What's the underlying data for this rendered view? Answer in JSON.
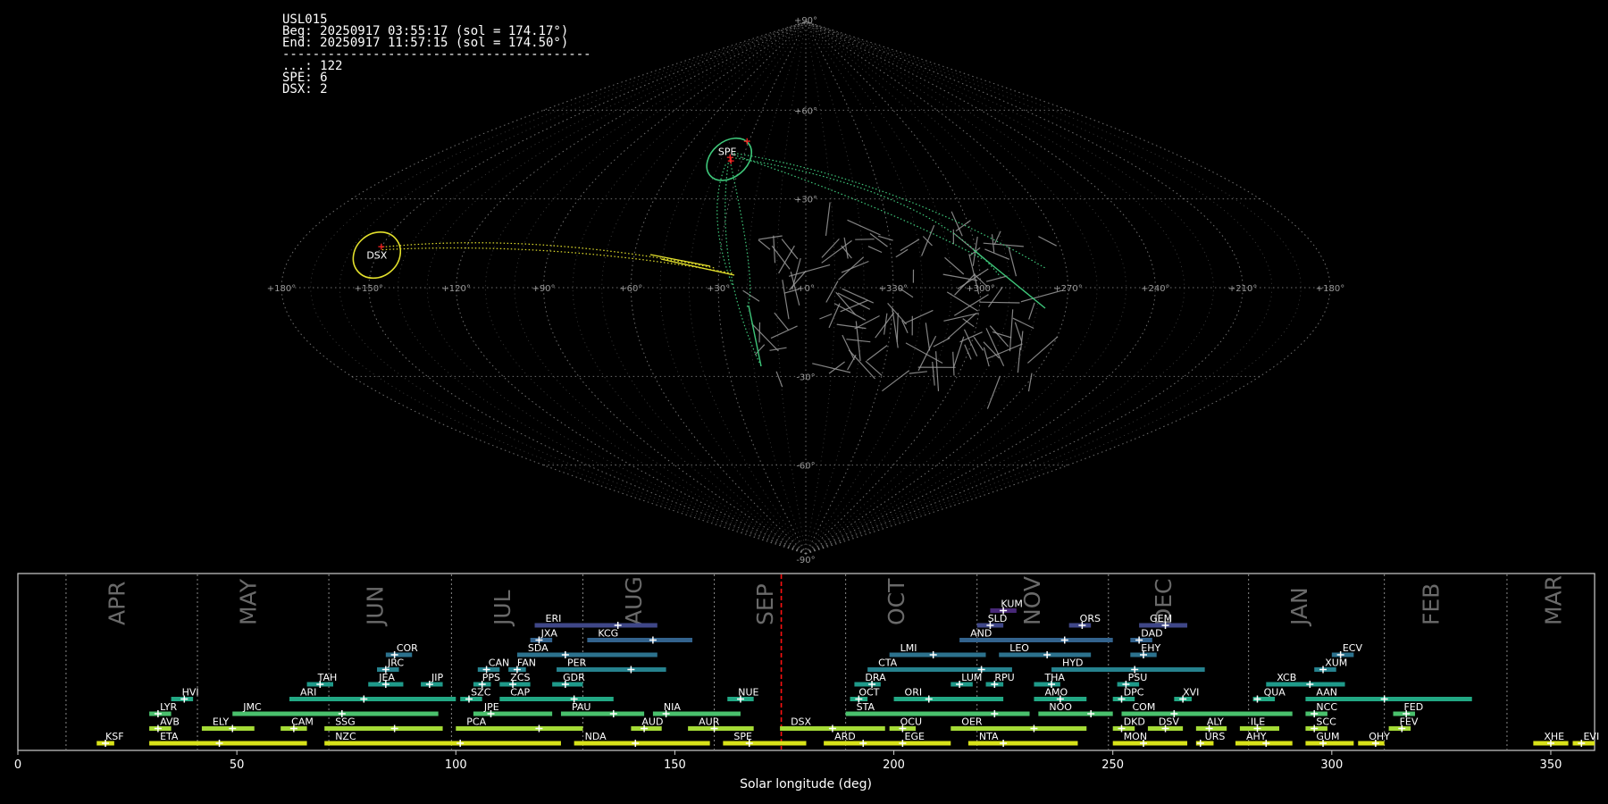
{
  "info": {
    "station": "USL015",
    "beg": "Beg: 20250917 03:55:17 (sol = 174.17°)",
    "end": "End: 20250917 11:57:15 (sol = 174.50°)",
    "separator": "-----------------------------------------",
    "counts": [
      "...: 122",
      "SPE: 6",
      "DSX: 2"
    ]
  },
  "colors": {
    "background": "#000000",
    "grid": "#8a8a8a",
    "sporadic_meteors": "#9a9a9a",
    "spe": "#3ec77a",
    "dsx": "#e3e02c",
    "radiant_marker": "#ff2020",
    "current_sol": "#ff1010"
  },
  "chart_data": [
    {
      "type": "scatter",
      "projection": "sinusoidal",
      "title": "",
      "lon_tick_labels": [
        "+180°",
        "+150°",
        "+120°",
        "+90°",
        "+60°",
        "+30°",
        "+0°",
        "+330°",
        "+300°",
        "+270°",
        "+240°",
        "+210°",
        "+180°"
      ],
      "lat_tick_labels": [
        "+90°",
        "+60°",
        "+30°",
        "-30°",
        "-60°",
        "-90°"
      ],
      "radiants": [
        {
          "name": "SPE",
          "lon": 37,
          "lat": 44,
          "count": 6
        },
        {
          "name": "DSX",
          "lon": 150,
          "lat": 11,
          "count": 2
        }
      ],
      "sporadic_count": 122
    },
    {
      "type": "gantt",
      "title": "",
      "xlabel": "Solar longitude (deg)",
      "xlim": [
        0,
        360
      ],
      "xticks": [
        0,
        50,
        100,
        150,
        200,
        250,
        300,
        350
      ],
      "current_sol": 174.3,
      "month_boundaries": [
        11,
        41,
        71,
        99,
        129,
        159,
        189,
        219,
        249,
        281,
        312,
        340
      ],
      "months": [
        {
          "label": "APR",
          "sol": 26
        },
        {
          "label": "MAY",
          "sol": 56
        },
        {
          "label": "JUN",
          "sol": 85
        },
        {
          "label": "JUL",
          "sol": 114
        },
        {
          "label": "AUG",
          "sol": 144
        },
        {
          "label": "SEP",
          "sol": 174
        },
        {
          "label": "OCT",
          "sol": 204
        },
        {
          "label": "NOV",
          "sol": 235
        },
        {
          "label": "DEC",
          "sol": 265
        },
        {
          "label": "JAN",
          "sol": 296
        },
        {
          "label": "FEB",
          "sol": 326
        },
        {
          "label": "MAR",
          "sol": 354
        }
      ],
      "showers": [
        {
          "code": "KSF",
          "start": 18,
          "end": 22,
          "peak": 20,
          "row": 0
        },
        {
          "code": "ETA",
          "start": 30,
          "end": 66,
          "peak": 46,
          "row": 0
        },
        {
          "code": "NZC",
          "start": 70,
          "end": 124,
          "peak": 101,
          "row": 0
        },
        {
          "code": "NDA",
          "start": 127,
          "end": 158,
          "peak": 141,
          "row": 0
        },
        {
          "code": "SPE",
          "start": 161,
          "end": 180,
          "peak": 167,
          "row": 0
        },
        {
          "code": "ARD",
          "start": 184,
          "end": 201,
          "peak": 193,
          "row": 0
        },
        {
          "code": "EGE",
          "start": 200,
          "end": 213,
          "peak": 202,
          "row": 0
        },
        {
          "code": "NTA",
          "start": 217,
          "end": 242,
          "peak": 225,
          "row": 0
        },
        {
          "code": "MON",
          "start": 250,
          "end": 267,
          "peak": 257,
          "row": 0
        },
        {
          "code": "URS",
          "start": 269,
          "end": 273,
          "peak": 270,
          "row": 0
        },
        {
          "code": "AHY",
          "start": 278,
          "end": 291,
          "peak": 285,
          "row": 0
        },
        {
          "code": "GUM",
          "start": 294,
          "end": 305,
          "peak": 298,
          "row": 0
        },
        {
          "code": "OHY",
          "start": 306,
          "end": 312,
          "peak": 310,
          "row": 0
        },
        {
          "code": "XHE",
          "start": 346,
          "end": 354,
          "peak": 350,
          "row": 0
        },
        {
          "code": "EVI",
          "start": 355,
          "end": 360,
          "peak": 357,
          "row": 0
        },
        {
          "code": "AVB",
          "start": 30,
          "end": 35,
          "peak": 32,
          "row": 1
        },
        {
          "code": "ELY",
          "start": 42,
          "end": 54,
          "peak": 49,
          "row": 1
        },
        {
          "code": "CAM",
          "start": 60,
          "end": 66,
          "peak": 63,
          "row": 1
        },
        {
          "code": "SSG",
          "start": 70,
          "end": 97,
          "peak": 86,
          "row": 1
        },
        {
          "code": "PCA",
          "start": 100,
          "end": 129,
          "peak": 119,
          "row": 1
        },
        {
          "code": "AUD",
          "start": 140,
          "end": 147,
          "peak": 143,
          "row": 1
        },
        {
          "code": "AUR",
          "start": 153,
          "end": 168,
          "peak": 159,
          "row": 1
        },
        {
          "code": "DSX",
          "start": 174,
          "end": 198,
          "peak": 186,
          "row": 1
        },
        {
          "code": "OCU",
          "start": 199,
          "end": 205,
          "peak": 202,
          "row": 1
        },
        {
          "code": "OER",
          "start": 213,
          "end": 244,
          "peak": 232,
          "row": 1
        },
        {
          "code": "DKD",
          "start": 250,
          "end": 255,
          "peak": 252,
          "row": 1
        },
        {
          "code": "DSV",
          "start": 258,
          "end": 266,
          "peak": 262,
          "row": 1
        },
        {
          "code": "ALY",
          "start": 269,
          "end": 276,
          "peak": 272,
          "row": 1
        },
        {
          "code": "ILE",
          "start": 279,
          "end": 288,
          "peak": 283,
          "row": 1
        },
        {
          "code": "SCC",
          "start": 294,
          "end": 299,
          "peak": 296,
          "row": 1
        },
        {
          "code": "FEV",
          "start": 313,
          "end": 318,
          "peak": 316,
          "row": 1
        },
        {
          "code": "LYR",
          "start": 30,
          "end": 35,
          "peak": 32,
          "row": 2
        },
        {
          "code": "JMC",
          "start": 49,
          "end": 96,
          "peak": 74,
          "row": 2
        },
        {
          "code": "JPE",
          "start": 104,
          "end": 122,
          "peak": 108,
          "row": 2
        },
        {
          "code": "PAU",
          "start": 124,
          "end": 143,
          "peak": 136,
          "row": 2
        },
        {
          "code": "NIA",
          "start": 145,
          "end": 165,
          "peak": 148,
          "row": 2
        },
        {
          "code": "STA",
          "start": 189,
          "end": 231,
          "peak": 223,
          "row": 2
        },
        {
          "code": "NOO",
          "start": 233,
          "end": 250,
          "peak": 245,
          "row": 2
        },
        {
          "code": "COM",
          "start": 252,
          "end": 291,
          "peak": 264,
          "row": 2
        },
        {
          "code": "NCC",
          "start": 294,
          "end": 299,
          "peak": 296,
          "row": 2
        },
        {
          "code": "FED",
          "start": 314,
          "end": 319,
          "peak": 317,
          "row": 2
        },
        {
          "code": "HVI",
          "start": 35,
          "end": 40,
          "peak": 38,
          "row": 3
        },
        {
          "code": "ARI",
          "start": 62,
          "end": 100,
          "peak": 79,
          "row": 3
        },
        {
          "code": "SZC",
          "start": 101,
          "end": 106,
          "peak": 103,
          "row": 3
        },
        {
          "code": "CAP",
          "start": 110,
          "end": 136,
          "peak": 127,
          "row": 3
        },
        {
          "code": "NUE",
          "start": 162,
          "end": 168,
          "peak": 165,
          "row": 3
        },
        {
          "code": "OCT",
          "start": 190,
          "end": 194,
          "peak": 192,
          "row": 3
        },
        {
          "code": "ORI",
          "start": 200,
          "end": 225,
          "peak": 208,
          "row": 3
        },
        {
          "code": "AMO",
          "start": 232,
          "end": 244,
          "peak": 238,
          "row": 3
        },
        {
          "code": "DPC",
          "start": 250,
          "end": 255,
          "peak": 252,
          "row": 3
        },
        {
          "code": "XVI",
          "start": 264,
          "end": 268,
          "peak": 266,
          "row": 3
        },
        {
          "code": "QUA",
          "start": 282,
          "end": 287,
          "peak": 283,
          "row": 3
        },
        {
          "code": "AAN",
          "start": 294,
          "end": 332,
          "peak": 312,
          "row": 3
        },
        {
          "code": "TAH",
          "start": 66,
          "end": 72,
          "peak": 69,
          "row": 4
        },
        {
          "code": "JEA",
          "start": 80,
          "end": 88,
          "peak": 84,
          "row": 4
        },
        {
          "code": "JIP",
          "start": 92,
          "end": 97,
          "peak": 94,
          "row": 4
        },
        {
          "code": "PPS",
          "start": 104,
          "end": 108,
          "peak": 106,
          "row": 4
        },
        {
          "code": "ZCS",
          "start": 110,
          "end": 117,
          "peak": 113,
          "row": 4
        },
        {
          "code": "GDR",
          "start": 122,
          "end": 129,
          "peak": 125,
          "row": 4
        },
        {
          "code": "DRA",
          "start": 191,
          "end": 197,
          "peak": 195,
          "row": 4
        },
        {
          "code": "LUM",
          "start": 213,
          "end": 218,
          "peak": 215,
          "row": 4
        },
        {
          "code": "RPU",
          "start": 221,
          "end": 225,
          "peak": 223,
          "row": 4
        },
        {
          "code": "THA",
          "start": 232,
          "end": 238,
          "peak": 236,
          "row": 4
        },
        {
          "code": "PSU",
          "start": 251,
          "end": 256,
          "peak": 253,
          "row": 4
        },
        {
          "code": "XCB",
          "start": 285,
          "end": 303,
          "peak": 295,
          "row": 4
        },
        {
          "code": "JRC",
          "start": 82,
          "end": 87,
          "peak": 84,
          "row": 5
        },
        {
          "code": "CAN",
          "start": 105,
          "end": 110,
          "peak": 107,
          "row": 5
        },
        {
          "code": "FAN",
          "start": 112,
          "end": 116,
          "peak": 114,
          "row": 5
        },
        {
          "code": "PER",
          "start": 123,
          "end": 148,
          "peak": 140,
          "row": 5
        },
        {
          "code": "CTA",
          "start": 194,
          "end": 227,
          "peak": 220,
          "row": 5
        },
        {
          "code": "HYD",
          "start": 236,
          "end": 271,
          "peak": 255,
          "row": 5
        },
        {
          "code": "XUM",
          "start": 296,
          "end": 301,
          "peak": 298,
          "row": 5
        },
        {
          "code": "COR",
          "start": 84,
          "end": 90,
          "peak": 86,
          "row": 6
        },
        {
          "code": "SDA",
          "start": 114,
          "end": 146,
          "peak": 125,
          "row": 6
        },
        {
          "code": "LMI",
          "start": 199,
          "end": 221,
          "peak": 209,
          "row": 6
        },
        {
          "code": "LEO",
          "start": 224,
          "end": 245,
          "peak": 235,
          "row": 6
        },
        {
          "code": "EHY",
          "start": 254,
          "end": 260,
          "peak": 257,
          "row": 6
        },
        {
          "code": "ECV",
          "start": 300,
          "end": 305,
          "peak": 302,
          "row": 6
        },
        {
          "code": "JXA",
          "start": 117,
          "end": 122,
          "peak": 119,
          "row": 7
        },
        {
          "code": "KCG",
          "start": 130,
          "end": 154,
          "peak": 145,
          "row": 7
        },
        {
          "code": "AND",
          "start": 215,
          "end": 250,
          "peak": 239,
          "row": 7
        },
        {
          "code": "DAD",
          "start": 254,
          "end": 259,
          "peak": 256,
          "row": 7
        },
        {
          "code": "ERI",
          "start": 118,
          "end": 146,
          "peak": 137,
          "row": 8
        },
        {
          "code": "SLD",
          "start": 219,
          "end": 225,
          "peak": 222,
          "row": 8
        },
        {
          "code": "ORS",
          "start": 240,
          "end": 245,
          "peak": 243,
          "row": 8
        },
        {
          "code": "GEM",
          "start": 256,
          "end": 267,
          "peak": 262,
          "row": 8
        },
        {
          "code": "KUM",
          "start": 222,
          "end": 228,
          "peak": 225,
          "row": 9
        }
      ]
    }
  ]
}
